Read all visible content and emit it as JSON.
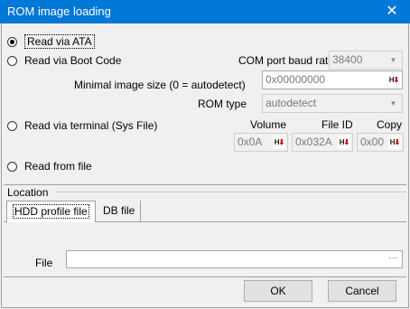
{
  "window": {
    "title": "ROM image loading",
    "close_glyph": "✕"
  },
  "modes": {
    "ata": "Read via ATA",
    "boot_code": "Read via Boot Code",
    "terminal": "Read via terminal (Sys File)",
    "file": "Read from file",
    "selected": "ata"
  },
  "boot_code": {
    "baud_label": "COM port baud rate",
    "baud_value": "38400",
    "image_size_label": "Minimal image size (0 = autodetect)",
    "image_size_value": "0x00000000",
    "rom_type_label": "ROM type",
    "rom_type_value": "autodetect"
  },
  "terminal": {
    "volume_label": "Volume",
    "volume_value": "0x0A",
    "file_id_label": "File ID",
    "file_id_value": "0x032A",
    "copy_label": "Copy",
    "copy_value": "0x00"
  },
  "location": {
    "label": "Location",
    "tabs": [
      "HDD profile file",
      "DB file"
    ],
    "active_tab": "HDD profile file",
    "file_label": "File",
    "file_value": "",
    "browse_glyph": "···"
  },
  "buttons": {
    "ok": "OK",
    "cancel": "Cancel"
  },
  "icons": {
    "dropdown": "dropdown-arrow-icon",
    "hex_toggle": "hex-arrow-icon",
    "browse": "ellipsis-icon"
  },
  "colors": {
    "titlebar": "#0078d7",
    "hex_arrow": "#d00000"
  }
}
